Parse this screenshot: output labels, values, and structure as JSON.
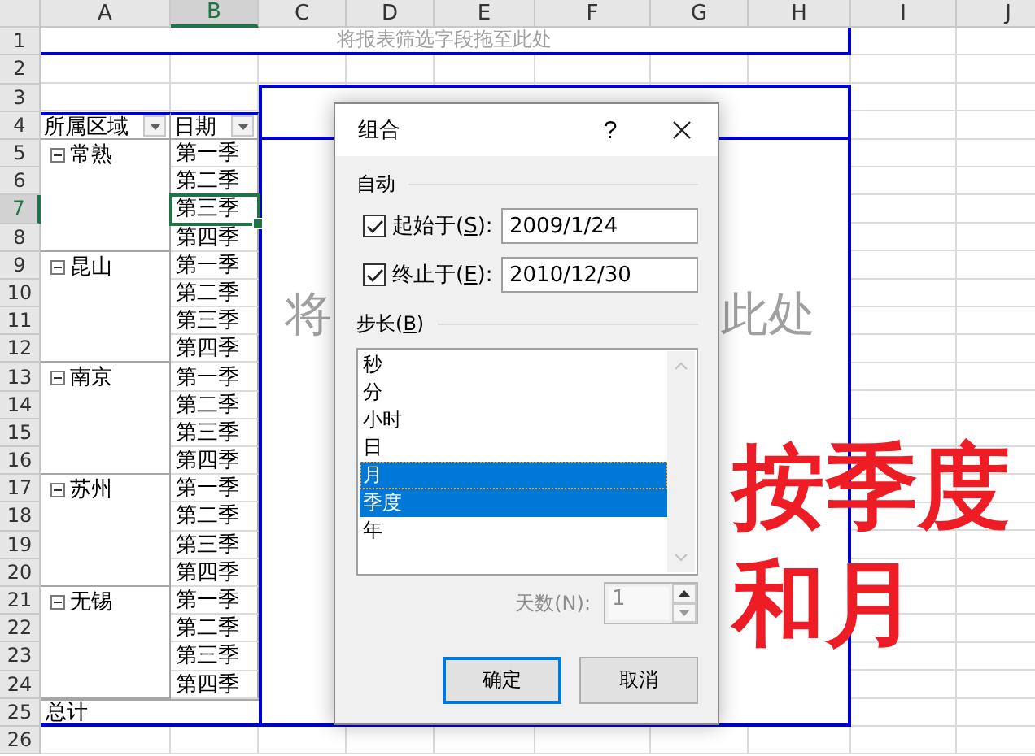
{
  "sheet": {
    "columns": [
      {
        "label": "A",
        "selected": false
      },
      {
        "label": "B",
        "selected": true
      },
      {
        "label": "C",
        "selected": false
      },
      {
        "label": "D",
        "selected": false
      },
      {
        "label": "E",
        "selected": false
      },
      {
        "label": "F",
        "selected": false
      },
      {
        "label": "G",
        "selected": false
      },
      {
        "label": "H",
        "selected": false
      },
      {
        "label": "I",
        "selected": false
      },
      {
        "label": "J",
        "selected": false
      }
    ],
    "rows": [
      {
        "label": "1",
        "selected": false
      },
      {
        "label": "2",
        "selected": false
      },
      {
        "label": "3",
        "selected": false
      },
      {
        "label": "4",
        "selected": false
      },
      {
        "label": "5",
        "selected": false
      },
      {
        "label": "6",
        "selected": false
      },
      {
        "label": "7",
        "selected": true
      },
      {
        "label": "8",
        "selected": false
      },
      {
        "label": "9",
        "selected": false
      },
      {
        "label": "10",
        "selected": false
      },
      {
        "label": "11",
        "selected": false
      },
      {
        "label": "12",
        "selected": false
      },
      {
        "label": "13",
        "selected": false
      },
      {
        "label": "14",
        "selected": false
      },
      {
        "label": "15",
        "selected": false
      },
      {
        "label": "16",
        "selected": false
      },
      {
        "label": "17",
        "selected": false
      },
      {
        "label": "18",
        "selected": false
      },
      {
        "label": "19",
        "selected": false
      },
      {
        "label": "20",
        "selected": false
      },
      {
        "label": "21",
        "selected": false
      },
      {
        "label": "22",
        "selected": false
      },
      {
        "label": "23",
        "selected": false
      },
      {
        "label": "24",
        "selected": false
      },
      {
        "label": "25",
        "selected": false
      },
      {
        "label": "26",
        "selected": false
      }
    ]
  },
  "pivot": {
    "filter_zone": "将报表筛选字段拖至此处",
    "value_zone_visible": [
      "将",
      "此处"
    ],
    "headers": [
      "所属区域",
      "日期"
    ],
    "groups": [
      {
        "name": "常熟",
        "expanded": true,
        "items": [
          {
            "label": "第一季",
            "selected": false
          },
          {
            "label": "第二季",
            "selected": false
          },
          {
            "label": "第三季",
            "selected": true
          },
          {
            "label": "第四季",
            "selected": false
          }
        ]
      },
      {
        "name": "昆山",
        "expanded": true,
        "items": [
          {
            "label": "第一季",
            "selected": false
          },
          {
            "label": "第二季",
            "selected": false
          },
          {
            "label": "第三季",
            "selected": false
          },
          {
            "label": "第四季",
            "selected": false
          }
        ]
      },
      {
        "name": "南京",
        "expanded": true,
        "items": [
          {
            "label": "第一季",
            "selected": false
          },
          {
            "label": "第二季",
            "selected": false
          },
          {
            "label": "第三季",
            "selected": false
          },
          {
            "label": "第四季",
            "selected": false
          }
        ]
      },
      {
        "name": "苏州",
        "expanded": true,
        "items": [
          {
            "label": "第一季",
            "selected": false
          },
          {
            "label": "第二季",
            "selected": false
          },
          {
            "label": "第三季",
            "selected": false
          },
          {
            "label": "第四季",
            "selected": false
          }
        ]
      },
      {
        "name": "无锡",
        "expanded": true,
        "items": [
          {
            "label": "第一季",
            "selected": false
          },
          {
            "label": "第二季",
            "selected": false
          },
          {
            "label": "第三季",
            "selected": false
          },
          {
            "label": "第四季",
            "selected": false
          }
        ]
      }
    ],
    "total": "总计"
  },
  "dialog": {
    "title": "组合",
    "help": "?",
    "auto_heading": "自动",
    "auto_rows": [
      {
        "label_before": "起始于(",
        "access_key": "S",
        "label_after": "):",
        "checked": true,
        "value": "2009/1/24"
      },
      {
        "label_before": "终止于(",
        "access_key": "E",
        "label_after": "):",
        "checked": true,
        "value": "2010/12/30"
      }
    ],
    "step_heading": {
      "label_before": "步长(",
      "access_key": "B",
      "label_after": ")"
    },
    "step_items": [
      {
        "label": "秒",
        "selected": false,
        "focused": false
      },
      {
        "label": "分",
        "selected": false,
        "focused": false
      },
      {
        "label": "小时",
        "selected": false,
        "focused": false
      },
      {
        "label": "日",
        "selected": false,
        "focused": false
      },
      {
        "label": "月",
        "selected": true,
        "focused": true
      },
      {
        "label": "季度",
        "selected": true,
        "focused": false
      },
      {
        "label": "年",
        "selected": false,
        "focused": false
      }
    ],
    "days": {
      "label": "天数(N):",
      "value": "1",
      "disabled": true
    },
    "buttons": [
      {
        "label": "确定",
        "default": true
      },
      {
        "label": "取消",
        "default": false
      }
    ]
  },
  "annotation": {
    "lines": [
      "按季度",
      "和月"
    ]
  }
}
